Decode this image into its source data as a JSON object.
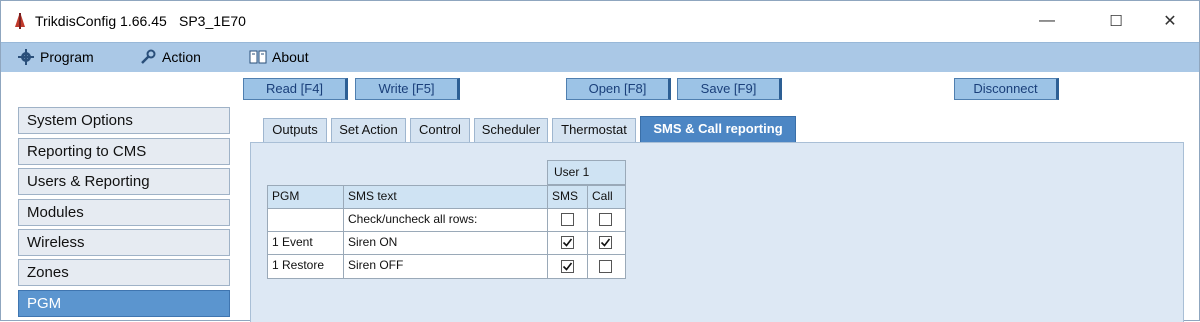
{
  "window": {
    "title": "TrikdisConfig 1.66.45",
    "file": "SP3_1E70",
    "minimize": "—",
    "maximize": "☐",
    "close": "✕"
  },
  "menu": [
    {
      "label": "Program",
      "icon": "gear-icon"
    },
    {
      "label": "Action",
      "icon": "wrench-icon"
    },
    {
      "label": "About",
      "icon": "book-icon"
    }
  ],
  "toolbar": {
    "read": "Read [F4]",
    "write": "Write [F5]",
    "open": "Open [F8]",
    "save": "Save [F9]",
    "disconnect": "Disconnect"
  },
  "nav": [
    {
      "label": "System Options",
      "active": false
    },
    {
      "label": "Reporting to CMS",
      "active": false
    },
    {
      "label": "Users & Reporting",
      "active": false
    },
    {
      "label": "Modules",
      "active": false
    },
    {
      "label": "Wireless",
      "active": false
    },
    {
      "label": "Zones",
      "active": false
    },
    {
      "label": "PGM",
      "active": true
    }
  ],
  "tabs": [
    {
      "label": "Outputs",
      "active": false
    },
    {
      "label": "Set Action",
      "active": false
    },
    {
      "label": "Control",
      "active": false
    },
    {
      "label": "Scheduler",
      "active": false
    },
    {
      "label": "Thermostat",
      "active": false
    },
    {
      "label": "SMS & Call reporting",
      "active": true
    }
  ],
  "table": {
    "group_header": "User 1",
    "columns": [
      "PGM",
      "SMS text",
      "SMS",
      "Call"
    ],
    "rows": [
      {
        "pgm": "",
        "text": "Check/uncheck all rows:",
        "sms": false,
        "call": false
      },
      {
        "pgm": "1 Event",
        "text": "Siren ON",
        "sms": true,
        "call": true
      },
      {
        "pgm": "1 Restore",
        "text": "Siren OFF",
        "sms": true,
        "call": false
      }
    ]
  },
  "colors": {
    "menubar": "#aac8e6",
    "active_nav": "#5b95cf",
    "active_tab": "#4c86c4",
    "panel": "#dde8f4"
  }
}
